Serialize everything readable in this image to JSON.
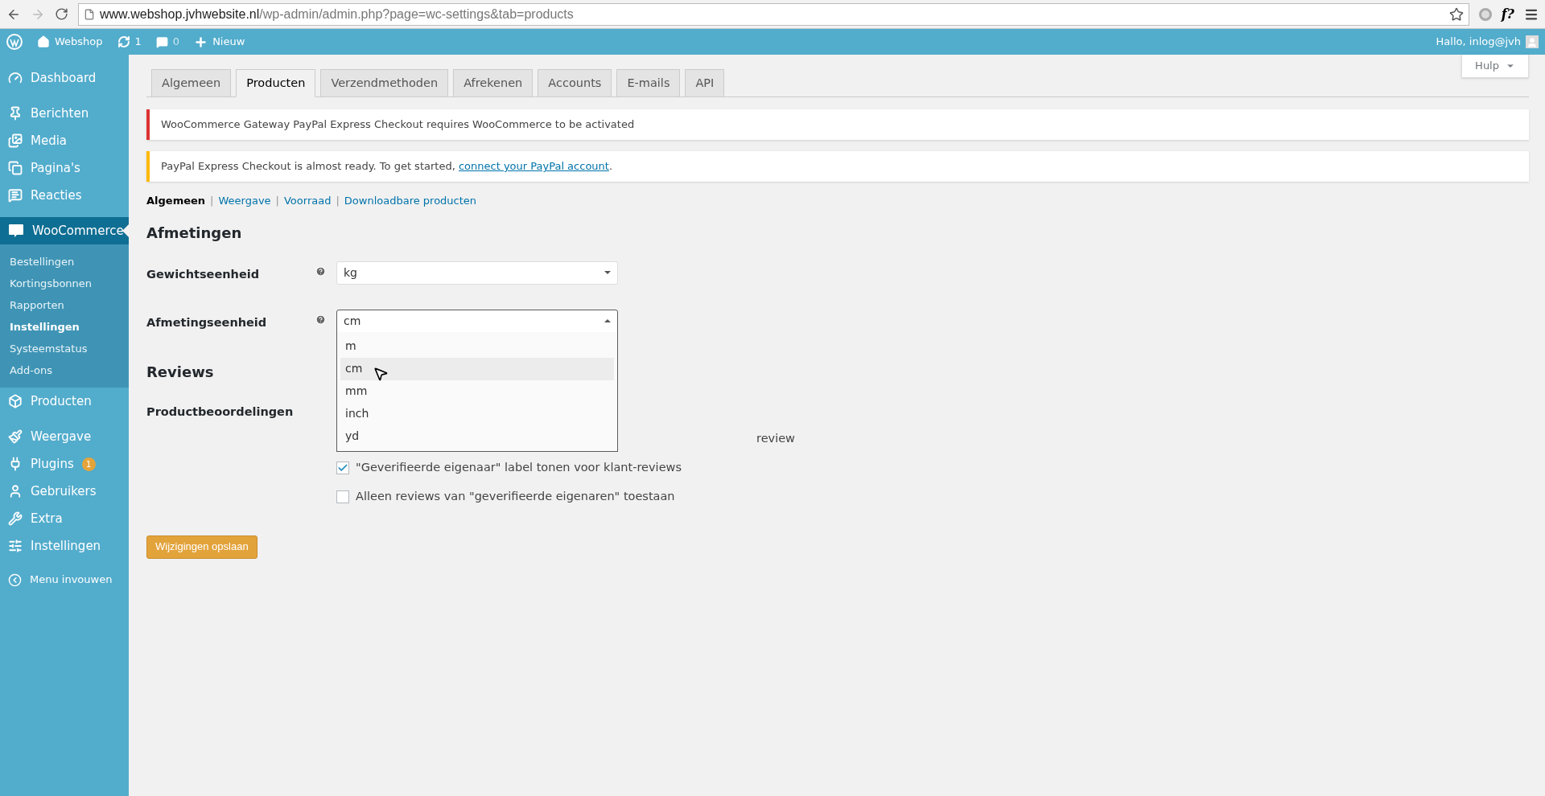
{
  "browser": {
    "url_host": "www.webshop.jvhwebsite.nl",
    "url_path": "/wp-admin/admin.php?page=wc-settings&tab=products",
    "extension_label": "f?"
  },
  "admin_bar": {
    "site": "Webshop",
    "updates": "1",
    "comments": "0",
    "new": "Nieuw",
    "greeting": "Hallo, inlog@jvh"
  },
  "help_button": "Hulp",
  "sidebar": {
    "groups": [
      [
        {
          "label": "Dashboard",
          "selected": false
        }
      ],
      [
        {
          "label": "Berichten",
          "selected": false
        },
        {
          "label": "Media",
          "selected": false
        },
        {
          "label": "Pagina's",
          "selected": false
        },
        {
          "label": "Reacties",
          "selected": false
        }
      ],
      [
        {
          "label": "WooCommerce",
          "selected": true,
          "children": [
            {
              "label": "Bestellingen",
              "selected": false
            },
            {
              "label": "Kortingsbonnen",
              "selected": false
            },
            {
              "label": "Rapporten",
              "selected": false
            },
            {
              "label": "Instellingen",
              "selected": true
            },
            {
              "label": "Systeemstatus",
              "selected": false
            },
            {
              "label": "Add-ons",
              "selected": false
            }
          ]
        },
        {
          "label": "Producten",
          "selected": false
        }
      ],
      [
        {
          "label": "Weergave",
          "selected": false
        },
        {
          "label": "Plugins",
          "selected": false,
          "badge": "1"
        },
        {
          "label": "Gebruikers",
          "selected": false
        },
        {
          "label": "Extra",
          "selected": false
        },
        {
          "label": "Instellingen",
          "selected": false
        }
      ]
    ],
    "collapse": "Menu invouwen"
  },
  "tabs": [
    {
      "label": "Algemeen",
      "selected": false
    },
    {
      "label": "Producten",
      "selected": true
    },
    {
      "label": "Verzendmethoden",
      "selected": false
    },
    {
      "label": "Afrekenen",
      "selected": false
    },
    {
      "label": "Accounts",
      "selected": false
    },
    {
      "label": "E-mails",
      "selected": false
    },
    {
      "label": "API",
      "selected": false
    }
  ],
  "notices": [
    {
      "kind": "error",
      "text": "WooCommerce Gateway PayPal Express Checkout requires WooCommerce to be activated"
    },
    {
      "kind": "warning",
      "text": "PayPal Express Checkout is almost ready. To get started, ",
      "link": "connect your PayPal account",
      "after": "."
    }
  ],
  "subnav_separator": "|",
  "subnav": [
    {
      "label": "Algemeen",
      "selected": true
    },
    {
      "label": "Weergave",
      "selected": false
    },
    {
      "label": "Voorraad",
      "selected": false
    },
    {
      "label": "Downloadbare producten",
      "selected": false
    }
  ],
  "sections": [
    {
      "title": "Afmetingen",
      "fields": [
        {
          "kind": "select",
          "label": "Gewichtseenheid",
          "value": "kg",
          "open": false
        },
        {
          "kind": "select",
          "label": "Afmetingseenheid",
          "value": "cm",
          "open": true,
          "options": [
            {
              "label": "m",
              "selected": false
            },
            {
              "label": "cm",
              "selected": true
            },
            {
              "label": "mm",
              "selected": false
            },
            {
              "label": "inch",
              "selected": false
            },
            {
              "label": "yd",
              "selected": false
            }
          ]
        }
      ]
    },
    {
      "title": "Reviews",
      "fields": [
        {
          "kind": "checkboxes",
          "label": "Productbeoordelingen",
          "lines": [
            {
              "text": "review",
              "covered": true
            },
            {
              "text": "\"Geverifieerde eigenaar\" label tonen voor klant-reviews",
              "checked": true
            },
            {
              "text": "Alleen reviews van \"geverifieerde eigenaren\" toestaan",
              "checked": false
            }
          ]
        }
      ]
    }
  ],
  "save_button": "Wijzigingen opslaan"
}
